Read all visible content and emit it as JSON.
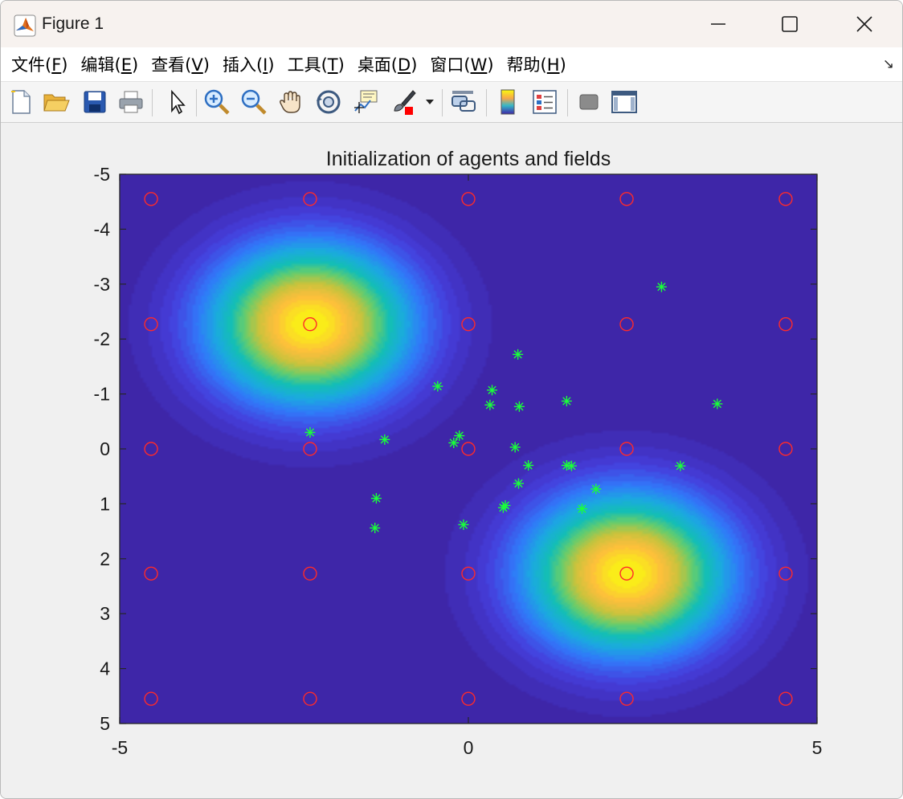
{
  "window": {
    "title": "Figure 1",
    "controls": [
      "minimize",
      "maximize",
      "close"
    ]
  },
  "menu": {
    "items": [
      {
        "label": "文件(",
        "key": "F",
        "tail": ")"
      },
      {
        "label": "编辑(",
        "key": "E",
        "tail": ")"
      },
      {
        "label": "查看(",
        "key": "V",
        "tail": ")"
      },
      {
        "label": "插入(",
        "key": "I",
        "tail": ")"
      },
      {
        "label": "工具(",
        "key": "T",
        "tail": ")"
      },
      {
        "label": "桌面(",
        "key": "D",
        "tail": ")"
      },
      {
        "label": "窗口(",
        "key": "W",
        "tail": ")"
      },
      {
        "label": "帮助(",
        "key": "H",
        "tail": ")"
      }
    ],
    "dock_icon": "↘"
  },
  "toolbar": {
    "icons": [
      "new-figure-icon",
      "open-file-icon",
      "save-icon",
      "print-icon",
      "select-arrow-icon",
      "zoom-in-icon",
      "zoom-out-icon",
      "pan-hand-icon",
      "rotate-3d-icon",
      "data-cursor-icon",
      "brush-icon",
      "dropdown-icon",
      "link-icon",
      "colorbar-icon",
      "legend-icon",
      "hide-plot-tools-icon",
      "show-plot-tools-icon"
    ]
  },
  "colors": {
    "field_low": "#3e26a8",
    "marker_circle": "#ff2a2a",
    "marker_agent": "#1aff3a"
  },
  "chart_data": {
    "type": "contour-scatter",
    "title": "Initialization of agents and fields",
    "xlabel": "",
    "ylabel": "",
    "xlim": [
      -5,
      5
    ],
    "ylim": [
      -5,
      5
    ],
    "y_reversed": true,
    "x_ticks": [
      -5,
      0,
      5
    ],
    "y_ticks": [
      -5,
      -4,
      -3,
      -2,
      -1,
      0,
      1,
      2,
      3,
      4,
      5
    ],
    "x_tick_labels": [
      "-5",
      "0",
      "5"
    ],
    "y_tick_labels": [
      "-5",
      "-4",
      "-3",
      "-2",
      "-1",
      "0",
      "1",
      "2",
      "3",
      "4",
      "5"
    ],
    "colormap": "parula",
    "fields": [
      {
        "center": [
          -2.27,
          -2.27
        ],
        "sigma": 1.0
      },
      {
        "center": [
          2.27,
          2.27
        ],
        "sigma": 1.0
      }
    ],
    "grid_points": {
      "marker": "circle",
      "x": [
        -4.55,
        -2.27,
        0,
        2.27,
        4.55
      ],
      "y": [
        -4.55,
        -2.27,
        0,
        2.27,
        4.55
      ]
    },
    "agents": {
      "marker": "asterisk",
      "points": [
        [
          2.77,
          -2.95
        ],
        [
          0.71,
          -1.72
        ],
        [
          -0.44,
          -1.14
        ],
        [
          0.34,
          -1.07
        ],
        [
          0.31,
          -0.8
        ],
        [
          0.73,
          -0.77
        ],
        [
          1.41,
          -0.87
        ],
        [
          3.57,
          -0.82
        ],
        [
          -2.27,
          -0.3
        ],
        [
          -1.2,
          -0.17
        ],
        [
          -0.13,
          -0.24
        ],
        [
          -0.21,
          -0.11
        ],
        [
          0.67,
          -0.03
        ],
        [
          0.86,
          0.3
        ],
        [
          1.41,
          0.3
        ],
        [
          1.48,
          0.31
        ],
        [
          3.04,
          0.31
        ],
        [
          0.72,
          0.63
        ],
        [
          1.83,
          0.73
        ],
        [
          -1.32,
          0.9
        ],
        [
          0.53,
          1.03
        ],
        [
          0.5,
          1.07
        ],
        [
          1.63,
          1.09
        ],
        [
          -0.07,
          1.38
        ],
        [
          -1.34,
          1.44
        ]
      ]
    }
  }
}
